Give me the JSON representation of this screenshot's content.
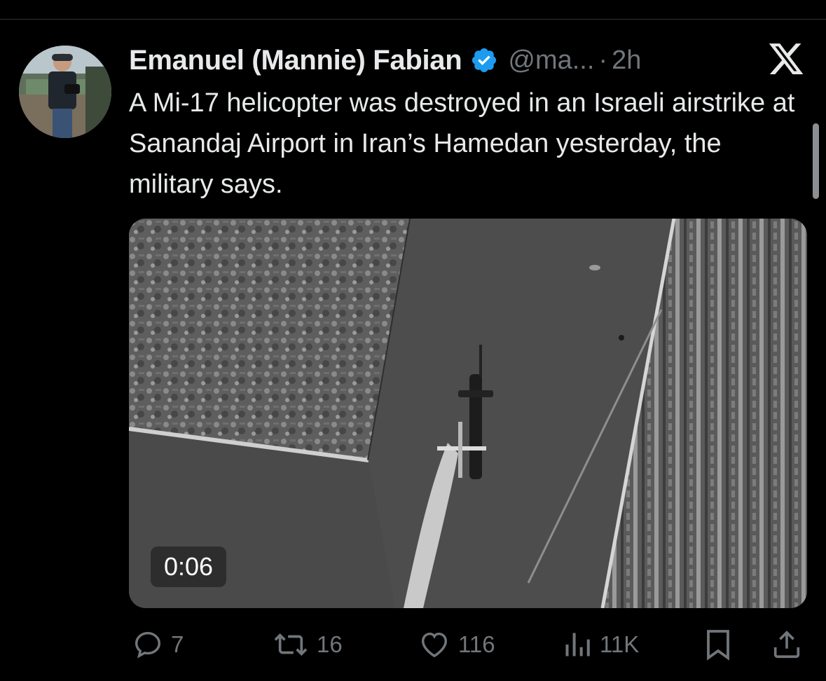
{
  "tweet": {
    "author_name": "Emanuel (Mannie) Fabian",
    "handle": "@ma...",
    "separator": "·",
    "time": "2h",
    "text": "A Mi-17 helicopter was destroyed in an Israeli airstrike at Sanandaj Airport in Iran’s Hamedan yesterday, the military says.",
    "media": {
      "duration": "0:06"
    }
  },
  "actions": {
    "replies": "7",
    "reposts": "16",
    "likes": "116",
    "views": "11K"
  },
  "icons": {
    "verified": "verified-badge-icon",
    "brand": "x-logo-icon",
    "reply": "reply-icon",
    "repost": "repost-icon",
    "like": "heart-icon",
    "views": "views-icon",
    "bookmark": "bookmark-icon",
    "share": "share-icon"
  },
  "colors": {
    "background": "#000000",
    "text": "#e7e9ea",
    "muted": "#71767b",
    "verified": "#1d9bf0"
  }
}
